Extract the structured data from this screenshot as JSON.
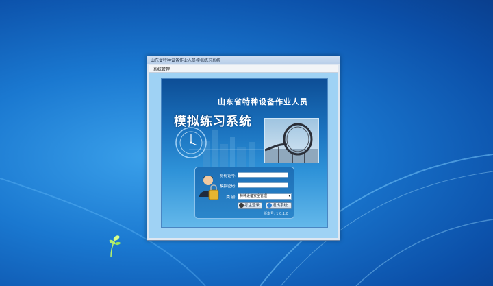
{
  "window": {
    "title": "山东省特种设备作业人员模拟练习系统",
    "menu_item": "系统管理"
  },
  "banner": {
    "line1": "山东省特种设备作业人员",
    "line2": "模拟练习系统"
  },
  "login": {
    "id_label": "身份证号:",
    "id_value": "",
    "password_label": "模拟密码:",
    "password_value": "",
    "category_label": "类    别:",
    "category_value": "特种设备安全管理",
    "login_button": "考生登录",
    "exit_button": "退出系统",
    "version": "版本号: 1.0.1.0"
  },
  "colors": {
    "desktop": "#1a78d0",
    "panel": "#1b73bf",
    "accent": "#8cc3ec"
  }
}
